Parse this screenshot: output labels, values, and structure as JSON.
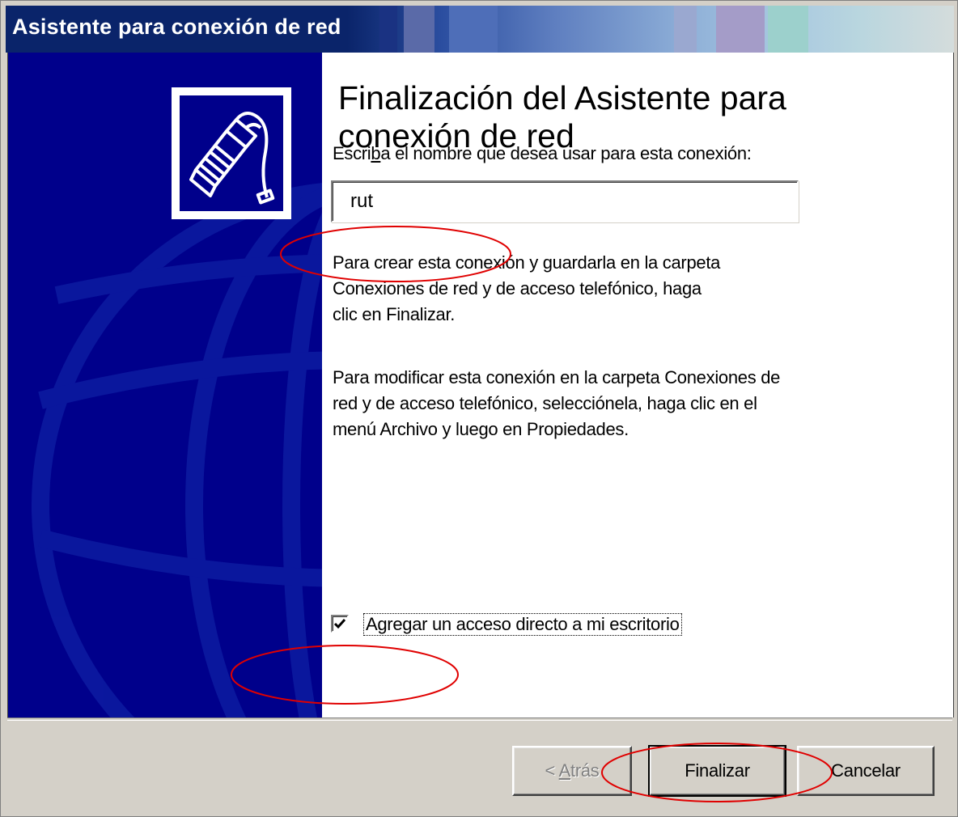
{
  "window": {
    "title": "Asistente para conexión de red"
  },
  "wizard": {
    "heading_line1": "Finalización del Asistente para",
    "heading_line2": "conexión de red",
    "name_prompt_before": "Escri",
    "name_prompt_mnemonic": "b",
    "name_prompt_after": "a el nombre que desea usar para esta conexión:",
    "connection_name_value": "rut",
    "create_paragraph": [
      "Para crear esta conexión y guardarla en la carpeta",
      "Conexiones de red y de acceso telefónico, haga",
      "clic en Finalizar."
    ],
    "modify_paragraph": [
      "Para modificar esta conexión en la carpeta Conexiones de",
      "red y de acceso telefónico, selecciónela, haga clic en el",
      "menú Archivo y luego en Propiedades."
    ],
    "shortcut_checkbox": {
      "label": "Agregar un acceso directo a mi escritorio",
      "checked": true
    }
  },
  "buttons": {
    "back_prefix": "< ",
    "back_mnemonic": "A",
    "back_rest": "trás",
    "finish": "Finalizar",
    "cancel": "Cancelar"
  },
  "icons": {
    "wizard_graphic": "network-cable-plug-icon",
    "checkbox_mark": "checkmark-icon"
  },
  "colors": {
    "title_bar_start": "#0a246a",
    "side_panel": "#00008b",
    "dialog_face": "#d4d0c8",
    "annotation_ellipse": "#e00000"
  }
}
